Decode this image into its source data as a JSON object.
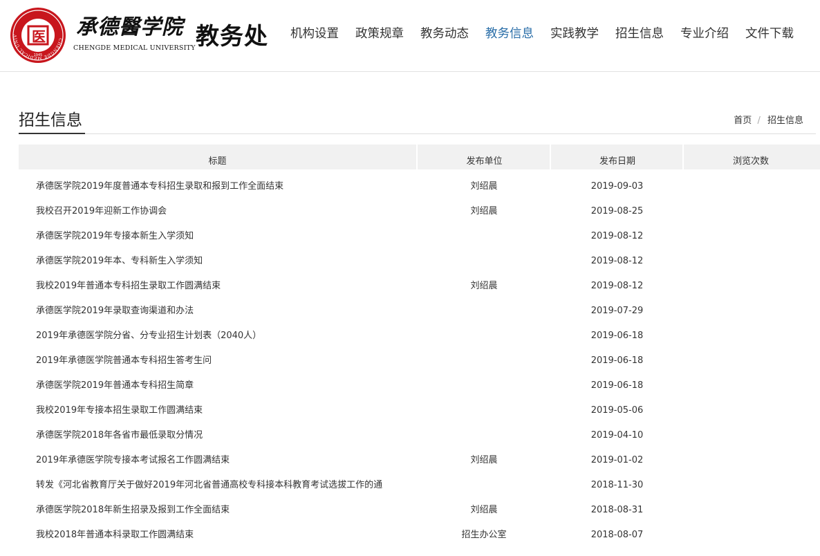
{
  "header": {
    "university_cn": "承德醫学院",
    "university_en": "CHENGDE MEDICAL UNIVERSITY",
    "office": "教务处",
    "seal_char": "医",
    "seal_year": "1945",
    "seal_ring_text": "CHENGDE MEDICAL UNIVERSITY",
    "brand_color": "#c8161d"
  },
  "nav": {
    "items": [
      {
        "label": "机构设置"
      },
      {
        "label": "政策规章"
      },
      {
        "label": "教务动态"
      },
      {
        "label": "教务信息",
        "active": true
      },
      {
        "label": "实践教学"
      },
      {
        "label": "招生信息"
      },
      {
        "label": "专业介绍"
      },
      {
        "label": "文件下载"
      }
    ]
  },
  "page": {
    "title": "招生信息",
    "breadcrumb": {
      "home": "首页",
      "separator": "/",
      "current": "招生信息"
    }
  },
  "table": {
    "headers": {
      "title": "标题",
      "unit": "发布单位",
      "date": "发布日期",
      "views": "浏览次数"
    },
    "rows": [
      {
        "title": "承德医学院2019年度普通本专科招生录取和报到工作全面结束",
        "unit": "刘绍晨",
        "date": "2019-09-03",
        "views": ""
      },
      {
        "title": "我校召开2019年迎新工作协调会",
        "unit": "刘绍晨",
        "date": "2019-08-25",
        "views": ""
      },
      {
        "title": "承德医学院2019年专接本新生入学须知",
        "unit": "",
        "date": "2019-08-12",
        "views": ""
      },
      {
        "title": "承德医学院2019年本、专科新生入学须知",
        "unit": "",
        "date": "2019-08-12",
        "views": ""
      },
      {
        "title": "我校2019年普通本专科招生录取工作圆满结束",
        "unit": "刘绍晨",
        "date": "2019-08-12",
        "views": ""
      },
      {
        "title": "承德医学院2019年录取查询渠道和办法",
        "unit": "",
        "date": "2019-07-29",
        "views": ""
      },
      {
        "title": "2019年承德医学院分省、分专业招生计划表（2040人）",
        "unit": "",
        "date": "2019-06-18",
        "views": ""
      },
      {
        "title": "2019年承德医学院普通本专科招生答考生问",
        "unit": "",
        "date": "2019-06-18",
        "views": ""
      },
      {
        "title": "承德医学院2019年普通本专科招生简章",
        "unit": "",
        "date": "2019-06-18",
        "views": ""
      },
      {
        "title": "我校2019年专接本招生录取工作圆满结束",
        "unit": "",
        "date": "2019-05-06",
        "views": ""
      },
      {
        "title": "承德医学院2018年各省市最低录取分情况",
        "unit": "",
        "date": "2019-04-10",
        "views": ""
      },
      {
        "title": "2019年承德医学院专接本考试报名工作圆满结束",
        "unit": "刘绍晨",
        "date": "2019-01-02",
        "views": ""
      },
      {
        "title": "转发《河北省教育厅关于做好2019年河北省普通高校专科接本科教育考试选拔工作的通",
        "unit": "",
        "date": "2018-11-30",
        "views": ""
      },
      {
        "title": "承德医学院2018年新生招录及报到工作全面结束",
        "unit": "刘绍晨",
        "date": "2018-08-31",
        "views": ""
      },
      {
        "title": "我校2018年普通本科录取工作圆满结束",
        "unit": "招生办公室",
        "date": "2018-08-07",
        "views": ""
      }
    ]
  }
}
